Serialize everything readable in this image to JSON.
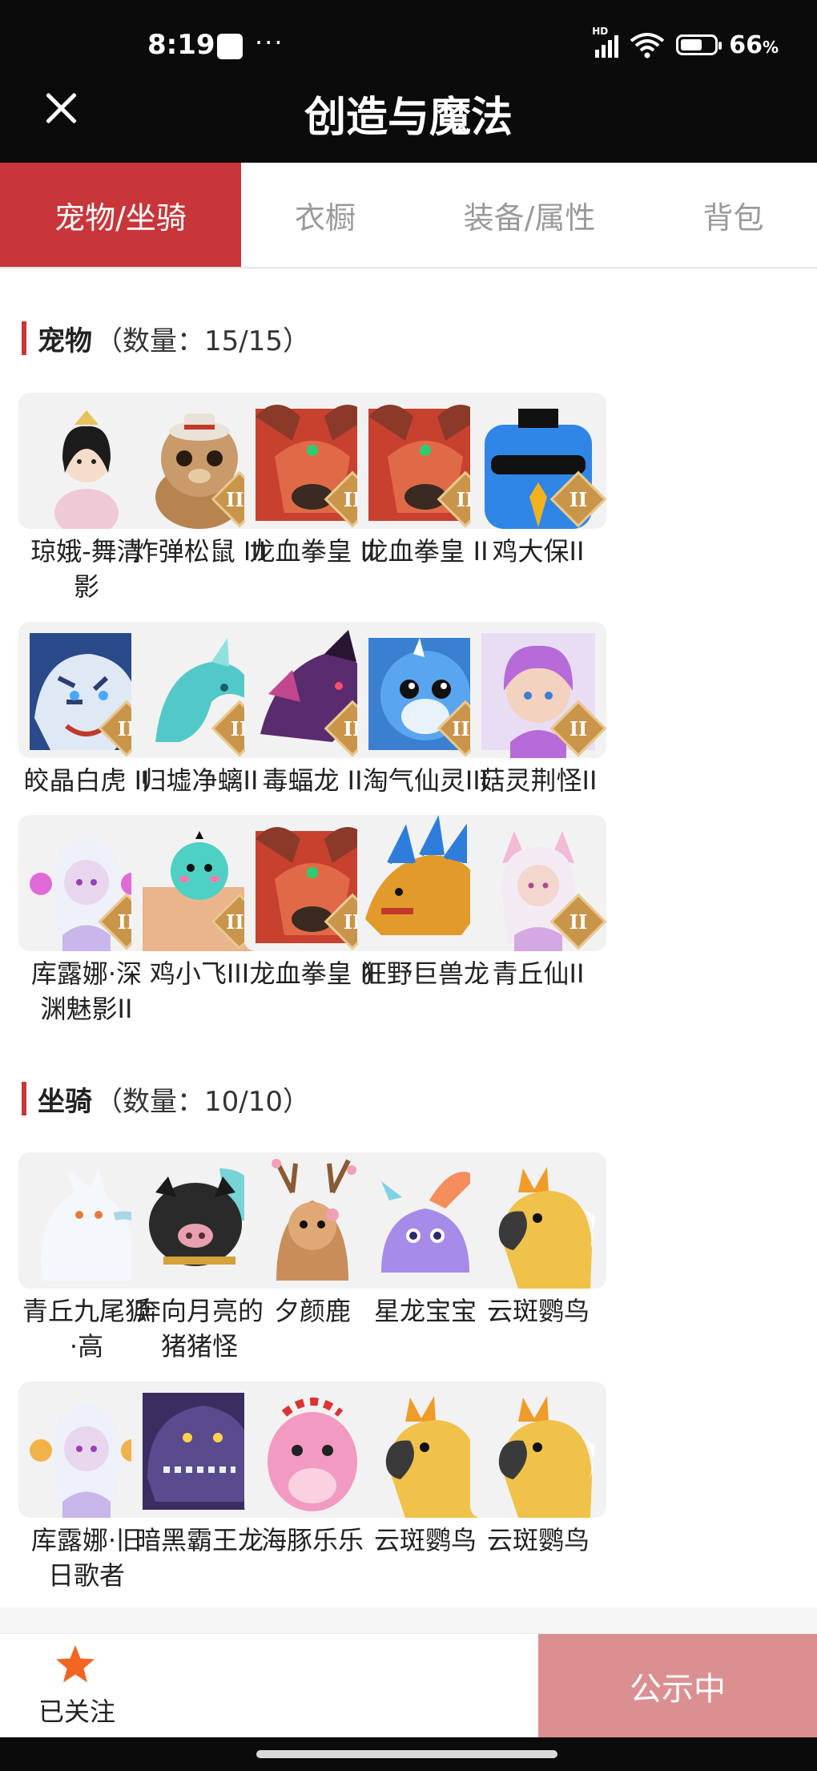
{
  "status_bar": {
    "time": "8:19",
    "dots": "···",
    "battery_percent": "66",
    "battery_suffix": "%",
    "battery_level": 0.66,
    "network_label": "HD"
  },
  "header": {
    "title": "创造与魔法"
  },
  "tabs": [
    {
      "label": "宠物/坐骑",
      "active": true
    },
    {
      "label": "衣橱",
      "active": false
    },
    {
      "label": "装备/属性",
      "active": false
    },
    {
      "label": "背包",
      "active": false
    }
  ],
  "sections": {
    "pets": {
      "name": "宠物",
      "count_text": "（数量：15/15）",
      "items": [
        {
          "name": "琼娥-舞清\n影",
          "tier": "",
          "art": "fairy-girl",
          "color": "#f3d9c6"
        },
        {
          "name": "炸弹松鼠 III",
          "tier": "III",
          "art": "squirrel",
          "color": "#c99a6a"
        },
        {
          "name": "龙血拳皇 II",
          "tier": "II",
          "art": "red-dragon",
          "color": "#c8412e"
        },
        {
          "name": "龙血拳皇 II",
          "tier": "II",
          "art": "red-dragon",
          "color": "#c8412e"
        },
        {
          "name": "鸡大保II",
          "tier": "II",
          "art": "blue-bird",
          "color": "#2f86e6"
        },
        {
          "name": "皎晶白虎 II",
          "tier": "II",
          "art": "white-tiger",
          "color": "#7f9fd1"
        },
        {
          "name": "归墟净螭II",
          "tier": "II",
          "art": "teal-dragon",
          "color": "#52c9c8"
        },
        {
          "name": "毒蝠龙 II",
          "tier": "II",
          "art": "purple-dragon",
          "color": "#5a2b6e"
        },
        {
          "name": "淘气仙灵III",
          "tier": "III",
          "art": "blue-pup",
          "color": "#3f8fe0"
        },
        {
          "name": "菇灵荆怪II",
          "tier": "II",
          "art": "purple-elf",
          "color": "#b66bd9"
        },
        {
          "name": "库露娜·深\n渊魅影II",
          "tier": "II",
          "art": "mermaid",
          "color": "#d9c8f2"
        },
        {
          "name": "鸡小飞III",
          "tier": "III",
          "art": "bird-muscle",
          "color": "#4ed1c4"
        },
        {
          "name": "龙血拳皇 II",
          "tier": "II",
          "art": "red-dragon",
          "color": "#c8412e"
        },
        {
          "name": "狂野巨兽龙",
          "tier": "",
          "art": "beast-dragon",
          "color": "#e29a2a"
        },
        {
          "name": "青丘仙II",
          "tier": "II",
          "art": "fox-girl",
          "color": "#e9c6e0"
        }
      ]
    },
    "mounts": {
      "name": "坐骑",
      "count_text": "（数量：10/10）",
      "items": [
        {
          "name": "青丘九尾狐\n·高",
          "tier": "",
          "art": "white-fox",
          "color": "#e8eef8"
        },
        {
          "name": "奔向月亮的\n猪猪怪",
          "tier": "",
          "art": "black-pig",
          "color": "#2a2a2a"
        },
        {
          "name": "夕颜鹿",
          "tier": "",
          "art": "deer",
          "color": "#c98d5a"
        },
        {
          "name": "星龙宝宝",
          "tier": "",
          "art": "star-dragon",
          "color": "#a78be8"
        },
        {
          "name": "云斑鹦鸟",
          "tier": "",
          "art": "parrot",
          "color": "#f0c24a"
        },
        {
          "name": "库露娜·旧\n日歌者",
          "tier": "",
          "art": "mermaid",
          "color": "#e6dcf6"
        },
        {
          "name": "暗黑霸王龙",
          "tier": "",
          "art": "dark-trex",
          "color": "#5a4a8e"
        },
        {
          "name": "海豚乐乐",
          "tier": "",
          "art": "pink-dolphin",
          "color": "#f29ac1"
        },
        {
          "name": "云斑鹦鸟",
          "tier": "",
          "art": "parrot",
          "color": "#f0c24a"
        },
        {
          "name": "云斑鹦鸟",
          "tier": "",
          "art": "parrot",
          "color": "#f0c24a"
        }
      ]
    }
  },
  "bottom_bar": {
    "follow_label": "已关注",
    "follow_icon": "star-icon",
    "public_label": "公示中"
  },
  "colors": {
    "accent": "#c8363a",
    "public_button": "#dc8f91",
    "star": "#f26522",
    "tier_badge": "#c9954a"
  }
}
